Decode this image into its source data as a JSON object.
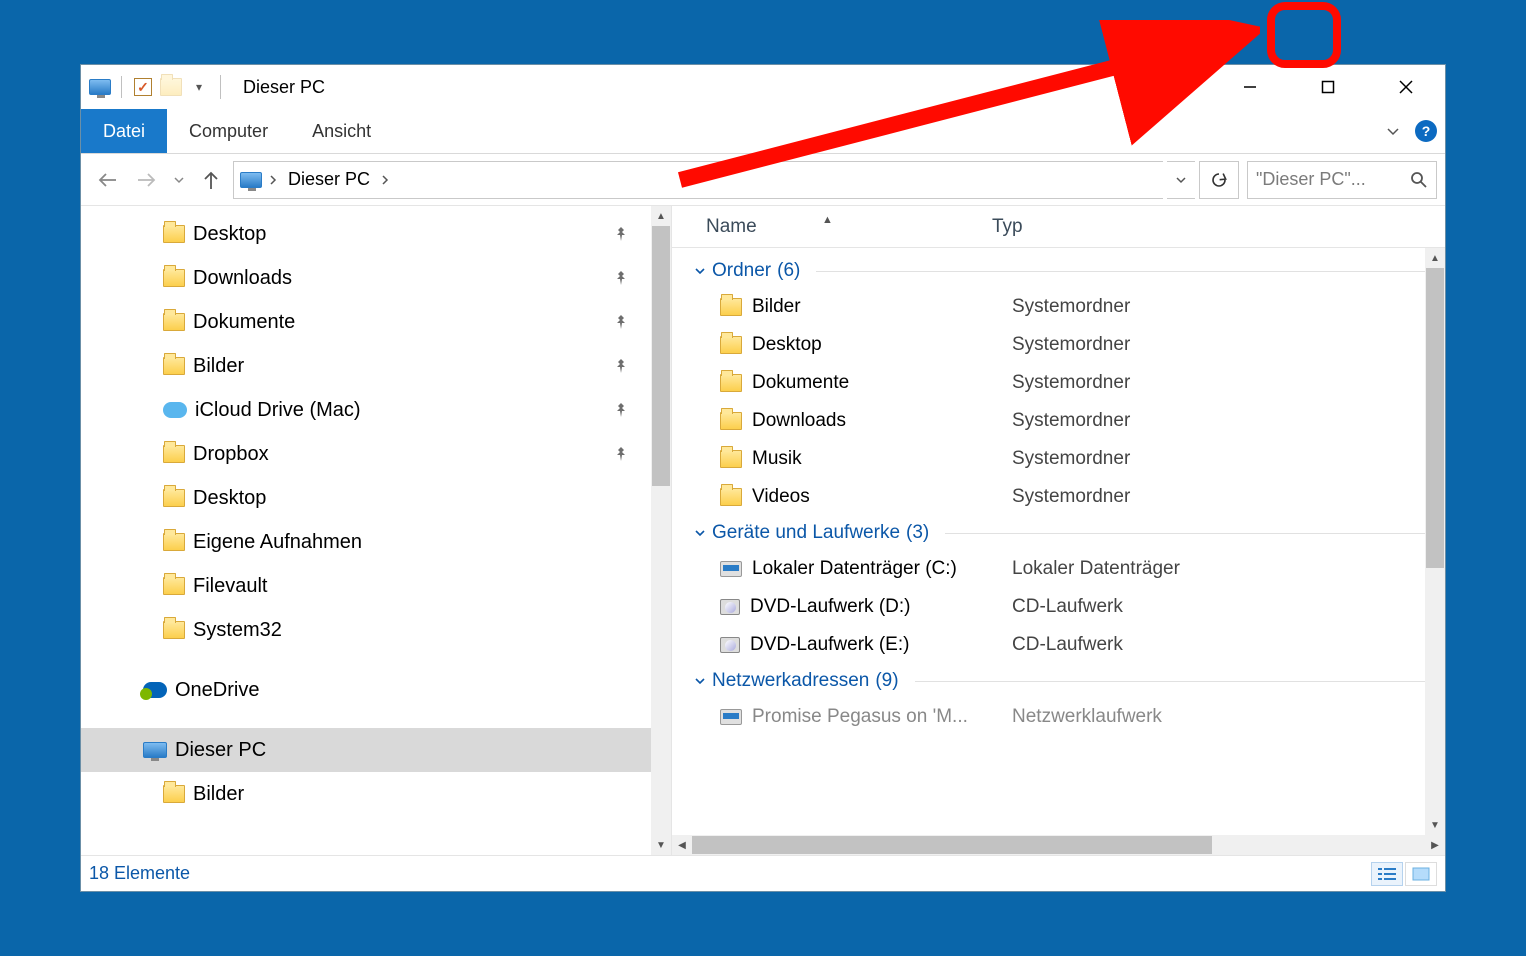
{
  "window": {
    "title": "Dieser PC"
  },
  "ribbon": {
    "file": "Datei",
    "computer": "Computer",
    "view": "Ansicht"
  },
  "breadcrumb": {
    "label": "Dieser PC"
  },
  "search": {
    "placeholder": "\"Dieser PC\"..."
  },
  "nav": {
    "items": [
      {
        "label": "Desktop",
        "icon": "folder",
        "pinned": true,
        "level": 2
      },
      {
        "label": "Downloads",
        "icon": "folder",
        "pinned": true,
        "level": 2
      },
      {
        "label": "Dokumente",
        "icon": "folder",
        "pinned": true,
        "level": 2
      },
      {
        "label": "Bilder",
        "icon": "folder",
        "pinned": true,
        "level": 2
      },
      {
        "label": "iCloud Drive (Mac)",
        "icon": "cloud",
        "pinned": true,
        "level": 2
      },
      {
        "label": "Dropbox",
        "icon": "folder",
        "pinned": true,
        "level": 2
      },
      {
        "label": "Desktop",
        "icon": "folder",
        "pinned": false,
        "level": 2
      },
      {
        "label": "Eigene Aufnahmen",
        "icon": "folder",
        "pinned": false,
        "level": 2
      },
      {
        "label": "Filevault",
        "icon": "folder",
        "pinned": false,
        "level": 2
      },
      {
        "label": "System32",
        "icon": "folder",
        "pinned": false,
        "level": 2
      },
      {
        "label": "OneDrive",
        "icon": "onedrive",
        "pinned": false,
        "level": 1,
        "spaced": true
      },
      {
        "label": "Dieser PC",
        "icon": "pc",
        "pinned": false,
        "level": 1,
        "spaced": true,
        "selected": true
      },
      {
        "label": "Bilder",
        "icon": "folder",
        "pinned": false,
        "level": 2
      }
    ]
  },
  "columns": {
    "name": "Name",
    "type": "Typ"
  },
  "groups": [
    {
      "label": "Ordner",
      "count": 6,
      "rows": [
        {
          "name": "Bilder",
          "type": "Systemordner",
          "icon": "folder"
        },
        {
          "name": "Desktop",
          "type": "Systemordner",
          "icon": "folder"
        },
        {
          "name": "Dokumente",
          "type": "Systemordner",
          "icon": "folder"
        },
        {
          "name": "Downloads",
          "type": "Systemordner",
          "icon": "folder"
        },
        {
          "name": "Musik",
          "type": "Systemordner",
          "icon": "folder"
        },
        {
          "name": "Videos",
          "type": "Systemordner",
          "icon": "folder"
        }
      ]
    },
    {
      "label": "Geräte und Laufwerke",
      "count": 3,
      "rows": [
        {
          "name": "Lokaler Datenträger (C:)",
          "type": "Lokaler Datenträger",
          "icon": "drive"
        },
        {
          "name": "DVD-Laufwerk (D:)",
          "type": "CD-Laufwerk",
          "icon": "dvd"
        },
        {
          "name": "DVD-Laufwerk (E:)",
          "type": "CD-Laufwerk",
          "icon": "dvd"
        }
      ]
    },
    {
      "label": "Netzwerkadressen",
      "count": 9,
      "rows": [
        {
          "name": "Promise Pegasus on 'M...",
          "type": "Netzwerklaufwerk",
          "icon": "drive",
          "cut": true
        }
      ]
    }
  ],
  "status": {
    "text": "18 Elemente"
  }
}
